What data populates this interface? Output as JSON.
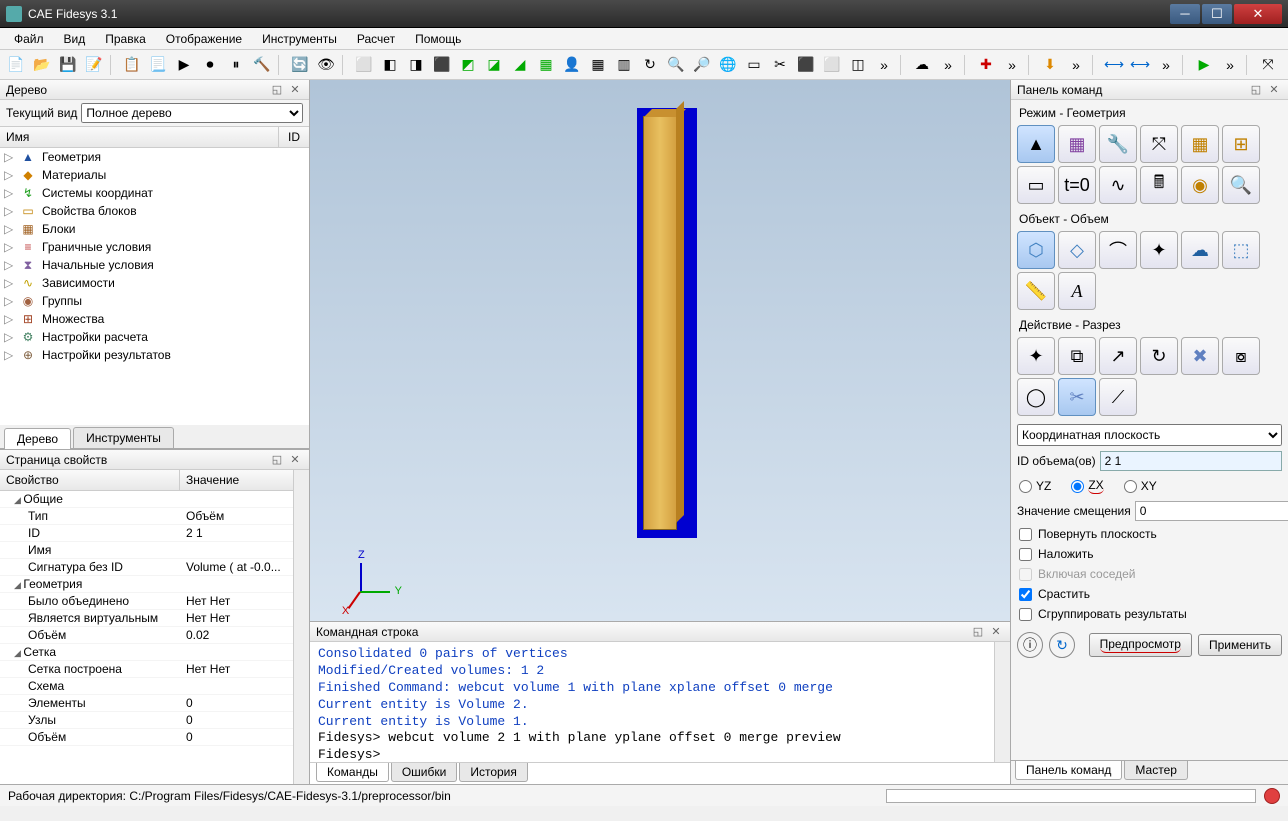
{
  "title": "CAE Fidesys 3.1",
  "menu": [
    "Файл",
    "Вид",
    "Правка",
    "Отображение",
    "Инструменты",
    "Расчет",
    "Помощь"
  ],
  "tree_panel": {
    "title": "Дерево",
    "view_label": "Текущий вид",
    "view_value": "Полное дерево",
    "col_name": "Имя",
    "col_id": "ID",
    "items": [
      {
        "icon": "▲",
        "color": "#2050a0",
        "label": "Геометрия"
      },
      {
        "icon": "◆",
        "color": "#d08000",
        "label": "Материалы"
      },
      {
        "icon": "↯",
        "color": "#20a020",
        "label": "Системы координат"
      },
      {
        "icon": "▭",
        "color": "#c08000",
        "label": "Свойства блоков"
      },
      {
        "icon": "▦",
        "color": "#a06020",
        "label": "Блоки"
      },
      {
        "icon": "≡",
        "color": "#c04040",
        "label": "Граничные условия"
      },
      {
        "icon": "⧗",
        "color": "#8060a0",
        "label": "Начальные условия"
      },
      {
        "icon": "∿",
        "color": "#c0a000",
        "label": "Зависимости"
      },
      {
        "icon": "◉",
        "color": "#a06040",
        "label": "Группы"
      },
      {
        "icon": "⊞",
        "color": "#a04020",
        "label": "Множества"
      },
      {
        "icon": "⚙",
        "color": "#408060",
        "label": "Настройки расчета"
      },
      {
        "icon": "⊕",
        "color": "#806040",
        "label": "Настройки результатов"
      }
    ],
    "tabs": [
      "Дерево",
      "Инструменты"
    ]
  },
  "props_panel": {
    "title": "Страница свойств",
    "col_prop": "Свойство",
    "col_val": "Значение",
    "rows": [
      {
        "group": true,
        "name": "Общие",
        "value": ""
      },
      {
        "name": "Тип",
        "value": "Объём"
      },
      {
        "name": "ID",
        "value": "2 1"
      },
      {
        "name": "Имя",
        "value": ""
      },
      {
        "name": "Сигнатура без ID",
        "value": "Volume ( at -0.0..."
      },
      {
        "group": true,
        "name": "Геометрия",
        "value": ""
      },
      {
        "name": "Было объединено",
        "value": "Нет Нет"
      },
      {
        "name": "Является виртуальным",
        "value": "Нет Нет"
      },
      {
        "name": "Объём",
        "value": "0.02"
      },
      {
        "group": true,
        "name": "Сетка",
        "value": ""
      },
      {
        "name": "Сетка построена",
        "value": "Нет Нет"
      },
      {
        "name": "Схема",
        "value": ""
      },
      {
        "name": "Элементы",
        "value": "0"
      },
      {
        "name": "Узлы",
        "value": "0"
      },
      {
        "name": "Объём",
        "value": "0"
      }
    ]
  },
  "cmdline": {
    "title": "Командная строка",
    "lines": [
      {
        "cls": "blue",
        "text": "Consolidated 0 pairs of vertices"
      },
      {
        "cls": "blue",
        "text": "Modified/Created volumes: 1 2"
      },
      {
        "cls": "blue",
        "text": "Finished Command: webcut volume 1 with plane xplane offset 0 merge"
      },
      {
        "cls": "blue",
        "text": "  Current entity is Volume 2."
      },
      {
        "cls": "blue",
        "text": "  Current entity is Volume 1."
      },
      {
        "cls": "blue",
        "text": " "
      },
      {
        "cls": "black",
        "text": "Fidesys> webcut volume 2 1  with plane yplane offset 0 merge preview"
      },
      {
        "cls": "black",
        "text": "Fidesys>"
      }
    ],
    "tabs": [
      "Команды",
      "Ошибки",
      "История"
    ]
  },
  "right": {
    "title": "Панель команд",
    "mode_label": "Режим - Геометрия",
    "object_label": "Объект - Объем",
    "action_label": "Действие - Разрез",
    "plane_dd": "Координатная плоскость",
    "id_label": "ID объема(ов)",
    "id_value": "2 1",
    "radios": {
      "yz": "YZ",
      "zx": "ZX",
      "xy": "XY"
    },
    "offset_label": "Значение смещения",
    "offset_value": "0",
    "chk_rotate": "Повернуть плоскость",
    "chk_imprint": "Наложить",
    "chk_neighbors": "Включая соседей",
    "chk_merge": "Срастить",
    "chk_group": "Сгруппировать результаты",
    "btn_preview": "Предпросмотр",
    "btn_apply": "Применить",
    "tabs": [
      "Панель команд",
      "Мастер"
    ]
  },
  "status": "Рабочая директория: C:/Program Files/Fidesys/CAE-Fidesys-3.1/preprocessor/bin"
}
